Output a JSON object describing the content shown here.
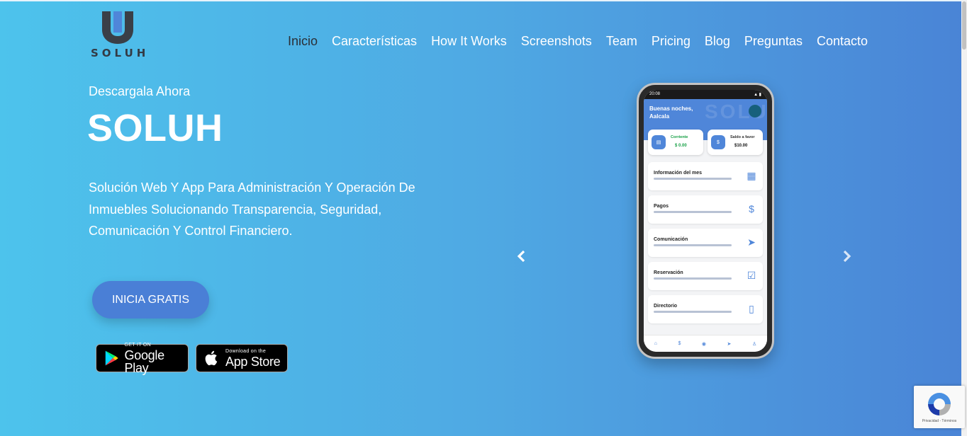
{
  "brand": {
    "name": "SOLUH",
    "logo_icon": "u-shield-logo"
  },
  "nav": {
    "items": [
      "Inicio",
      "Características",
      "How It Works",
      "Screenshots",
      "Team",
      "Pricing",
      "Blog",
      "Preguntas",
      "Contacto"
    ],
    "active": "Inicio"
  },
  "hero": {
    "eyebrow": "Descargala Ahora",
    "title": "SOLUH",
    "description": "Solución Web Y App Para Administración Y Operación De Inmuebles Solucionando Transparencia, Seguridad, Comunicación Y Control Financiero.",
    "cta_label": "INICIA GRATIS"
  },
  "stores": {
    "google": {
      "small": "GET IT ON",
      "big": "Google Play",
      "icon": "google-play-icon"
    },
    "apple": {
      "small": "Download on the",
      "big": "App Store",
      "icon": "apple-icon"
    }
  },
  "carousel": {
    "prev_icon": "chevron-left-icon",
    "next_icon": "chevron-right-icon"
  },
  "phone": {
    "status_time": "20:08",
    "greeting": "Buenas noches, Aalcala",
    "bg_word": "SOLUH",
    "balances": [
      {
        "label": "Corriente",
        "value": "$ 0.00"
      },
      {
        "label": "Saldo a favor",
        "value": "$10.00"
      }
    ],
    "menu": [
      "Información del mes",
      "Pagos",
      "Comunicación",
      "Reservación",
      "Directorio"
    ]
  },
  "recaptcha": {
    "text": "Privacidad - Términos"
  },
  "colors": {
    "accent": "#4a7fd6",
    "gradient_start": "#4dc3ec",
    "gradient_end": "#4a84d6",
    "nav_active": "#2b2f36"
  }
}
